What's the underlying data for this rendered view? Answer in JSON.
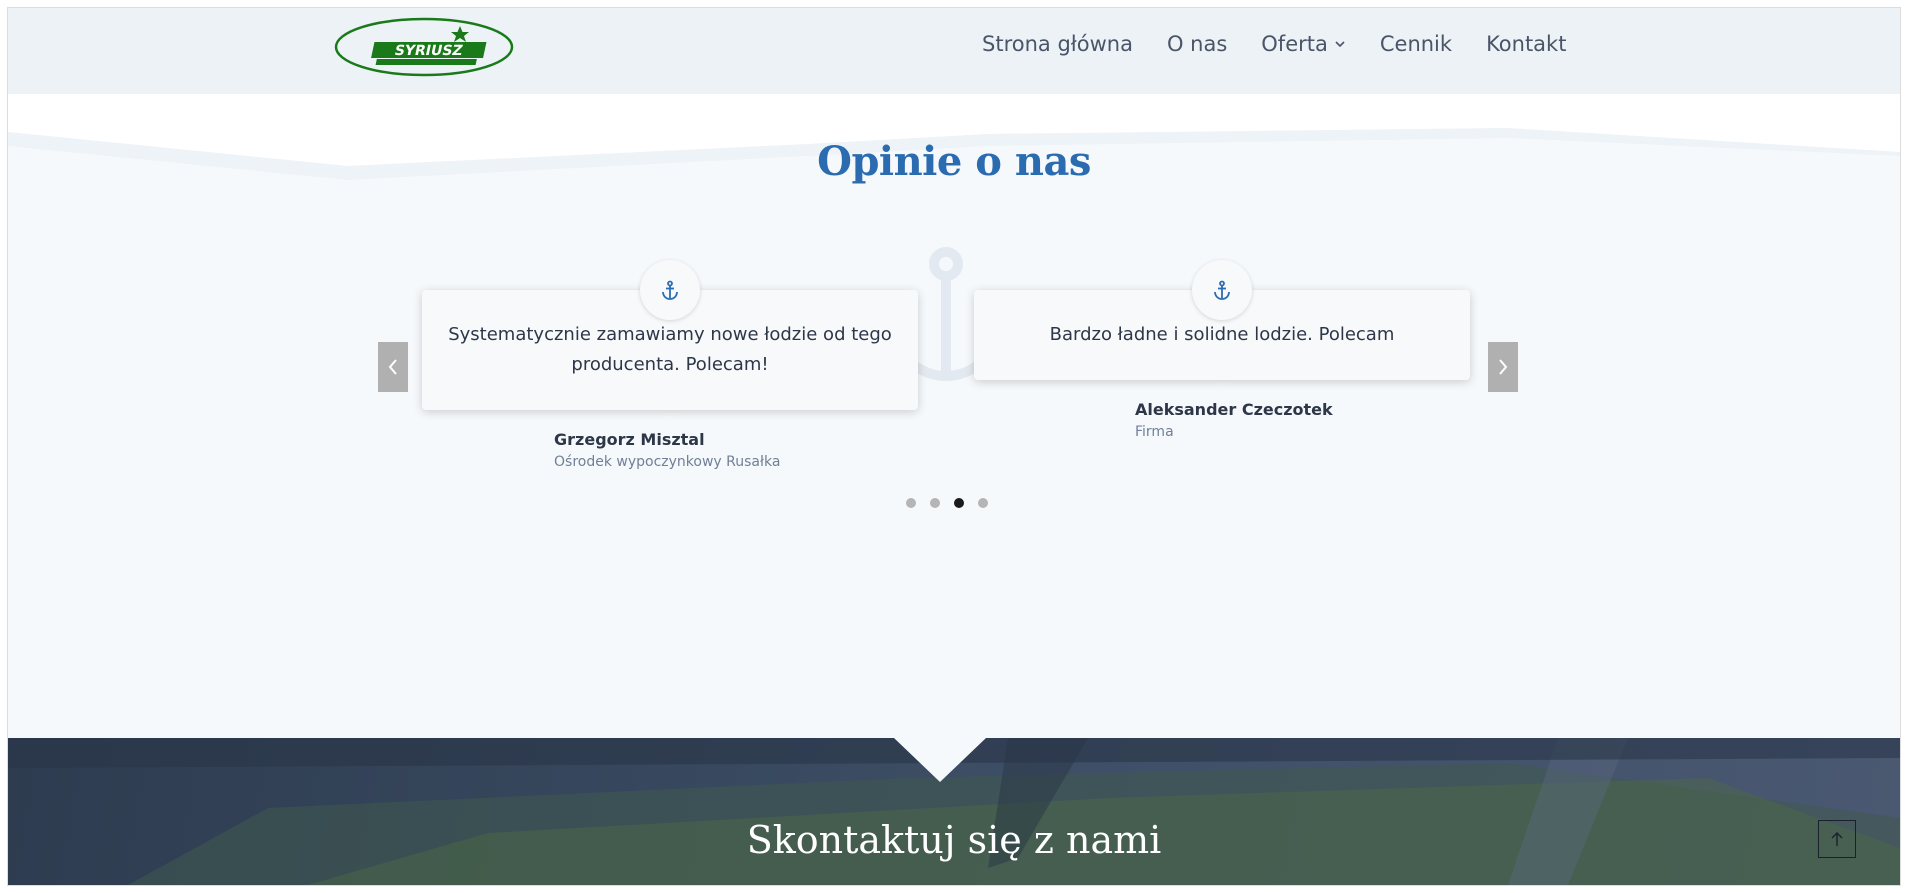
{
  "header": {
    "logo_text": "SYRIUSZ",
    "nav": [
      {
        "label": "Strona główna"
      },
      {
        "label": "O nas"
      },
      {
        "label": "Oferta"
      },
      {
        "label": "Cennik"
      },
      {
        "label": "Kontakt"
      }
    ]
  },
  "testimonials": {
    "title": "Opinie o nas",
    "items": [
      {
        "text": "Systematycznie zamawiamy nowe łodzie od tego producenta. Polecam!",
        "name": "Grzegorz Misztal",
        "org": "Ośrodek wypoczynkowy Rusałka",
        "icon": "anchor-icon"
      },
      {
        "text": "Bardzo ładne i solidne lodzie. Polecam",
        "name": "Aleksander Czeczotek",
        "org": "Firma",
        "icon": "anchor-icon"
      }
    ],
    "pagination": {
      "total": 4,
      "active": 3
    }
  },
  "contact": {
    "title": "Skontaktuj się z nami"
  },
  "colors": {
    "accent": "#2b6cb0",
    "logo_green": "#1a7a1a",
    "header_bg": "#edf2f7",
    "section_bg": "#f6f9fc"
  }
}
